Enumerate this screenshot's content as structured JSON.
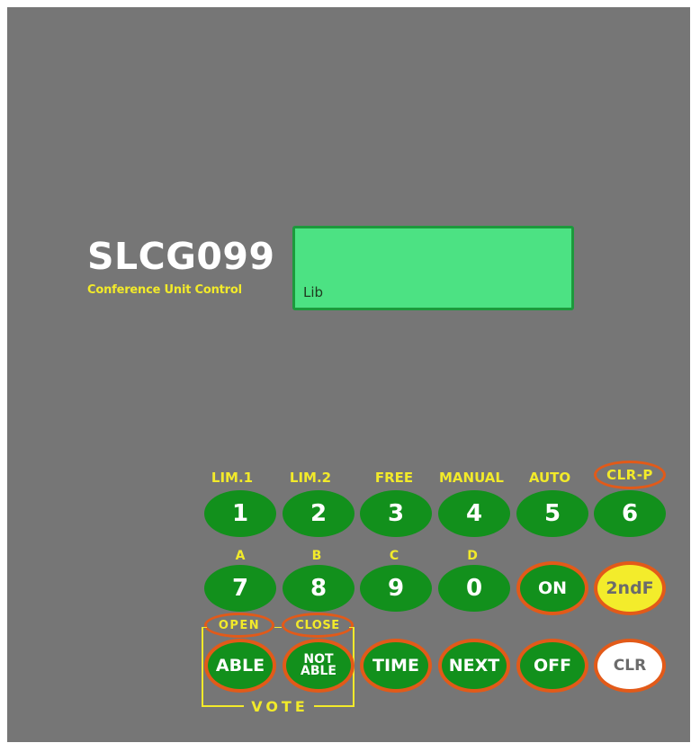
{
  "brand": {
    "title": "SLCG099",
    "subtitle": "Conference Unit Control"
  },
  "display": {
    "text": "Lib"
  },
  "keypad": {
    "row1_labels": [
      "LIM.1",
      "LIM.2",
      "FREE",
      "MANUAL",
      "AUTO",
      "CLR-P"
    ],
    "row1_keys": [
      "1",
      "2",
      "3",
      "4",
      "5",
      "6"
    ],
    "row2_labels": [
      "A",
      "B",
      "C",
      "D"
    ],
    "row2_keys": [
      "7",
      "8",
      "9",
      "0",
      "ON",
      "2ndF"
    ],
    "row3_labels": [
      "OPEN",
      "CLOSE"
    ],
    "row3_keys": [
      "ABLE",
      "NOT ABLE",
      "TIME",
      "NEXT",
      "OFF",
      "CLR"
    ],
    "not_able_lines": [
      "NOT",
      "ABLE"
    ],
    "vote_label": "VOTE"
  },
  "colors": {
    "panel": "#767676",
    "key_green": "#12901c",
    "label_yellow": "#f2ea2a",
    "ring_orange": "#e25a19",
    "display_green": "#4ce283",
    "second_function": "#f3ec2b"
  }
}
